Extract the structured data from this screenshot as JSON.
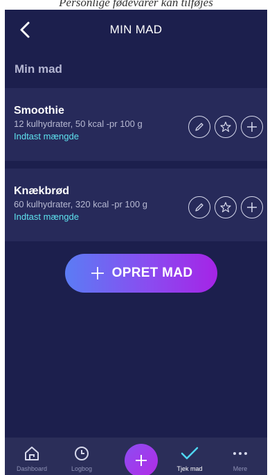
{
  "caption": "Personlige fødevarer kan tilføjes",
  "header": {
    "title": "MIN MAD",
    "back_icon": "chevron-left-icon"
  },
  "section_title": "Min mad",
  "foods": [
    {
      "name": "Smoothie",
      "info": "12 kulhydrater, 50 kcal -pr 100 g",
      "enter_label": "Indtast mængde",
      "actions": [
        "pencil-icon",
        "star-icon",
        "plus-icon"
      ]
    },
    {
      "name": "Knækbrød",
      "info": "60 kulhydrater, 320 kcal -pr 100 g",
      "enter_label": "Indtast mængde",
      "actions": [
        "pencil-icon",
        "star-icon",
        "plus-icon"
      ]
    }
  ],
  "create_button": {
    "label": "OPRET MAD"
  },
  "tabbar": {
    "items": [
      {
        "label": "Dashboard",
        "icon": "home-icon"
      },
      {
        "label": "Logbog",
        "icon": "clock-icon"
      },
      {
        "label": "",
        "icon": "plus-icon"
      },
      {
        "label": "Tjek mad",
        "icon": "check-icon"
      },
      {
        "label": "Mere",
        "icon": "more-icon"
      }
    ],
    "active": "Tjek mad"
  },
  "colors": {
    "background": "#1c1f4d",
    "card": "#272a5a",
    "link": "#5ee2ee",
    "accent_start": "#5b7cf4",
    "accent_end": "#a524e6"
  }
}
